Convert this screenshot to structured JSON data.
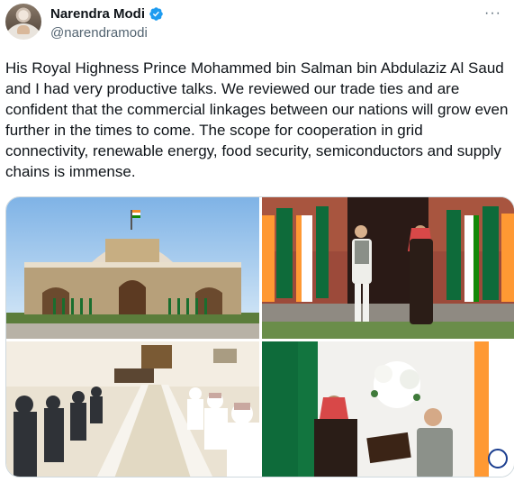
{
  "author": {
    "name": "Narendra Modi",
    "handle": "@narendramodi",
    "verified_icon": "verified-badge-icon",
    "more_glyph": "···"
  },
  "tweet": {
    "text": "His Royal Highness Prince Mohammed bin Salman bin Abdulaziz Al Saud and I had very productive talks. We reviewed our trade ties and are confident that the commercial linkages between our nations will grow even further in the times to come. The scope for cooperation in grid connectivity, renewable energy, food security, semiconductors and supply chains is immense."
  },
  "media": {
    "count": 4
  },
  "colors": {
    "text": "#0f1419",
    "secondary": "#536471",
    "verified": "#1d9bf0",
    "border": "#cfd9de"
  }
}
